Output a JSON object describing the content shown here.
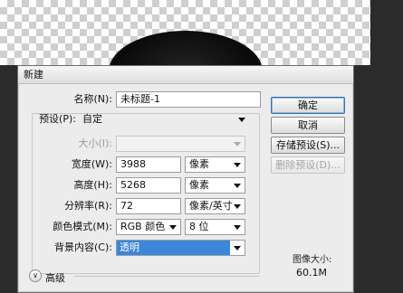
{
  "dialog": {
    "title": "新建",
    "name_label": "名称(N):",
    "name_value": "未标题-1",
    "preset_label": "预设(P):",
    "preset_value": "自定",
    "size_label": "大小(I):",
    "size_value": "",
    "width_label": "宽度(W):",
    "width_value": "3988",
    "width_unit": "像素",
    "height_label": "高度(H):",
    "height_value": "5268",
    "height_unit": "像素",
    "resolution_label": "分辨率(R):",
    "resolution_value": "72",
    "resolution_unit": "像素/英寸",
    "color_mode_label": "颜色模式(M):",
    "color_mode_value": "RGB 颜色",
    "bit_depth_value": "8 位",
    "background_label": "背景内容(C):",
    "background_value": "透明",
    "advanced_label": "高级",
    "image_size_label": "图像大小:",
    "image_size_value": "60.1M"
  },
  "buttons": {
    "ok": "确定",
    "cancel": "取消",
    "save_preset": "存储预设(S)...",
    "delete_preset": "删除预设(D)..."
  },
  "colors": {
    "selection": "#3b86d8",
    "dialog_bg": "#ececec"
  }
}
